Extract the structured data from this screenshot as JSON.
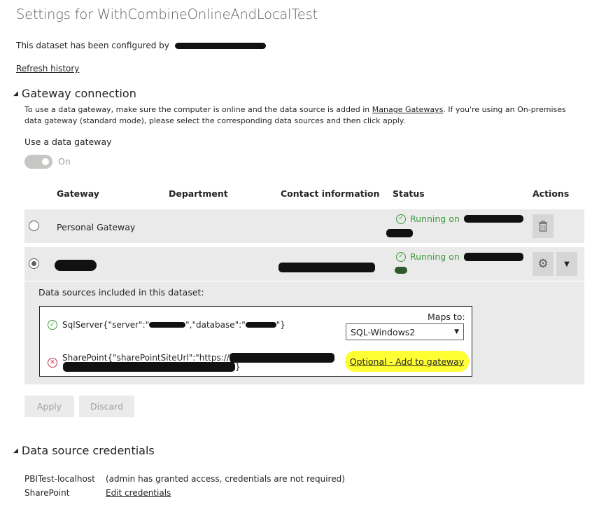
{
  "page": {
    "title": "Settings for WithCombineOnlineAndLocalTest",
    "configured_by": "This dataset has been configured by",
    "refresh_history": "Refresh history"
  },
  "gateway": {
    "section_title": "Gateway connection",
    "desc_before": "To use a data gateway, make sure the computer is online and the data source is added in ",
    "manage_link": "Manage Gateways",
    "desc_after": ". If you're using an On-premises data gateway (standard mode), please select the corresponding data sources and then click apply.",
    "use_label": "Use a data gateway",
    "toggle_label": "On",
    "columns": {
      "gateway": "Gateway",
      "department": "Department",
      "contact": "Contact information",
      "status": "Status",
      "actions": "Actions"
    },
    "rows": [
      {
        "name": "Personal Gateway",
        "status": "Running on"
      },
      {
        "name": "",
        "status": "Running on"
      }
    ],
    "data_sources": {
      "title": "Data sources included in this dataset:",
      "maps_to": "Maps to:",
      "sql_source": "SqlServer{\"server\":\"",
      "sql_mid": "\",\"database\":\"",
      "sql_end": "\"}",
      "sql_mapping": "SQL-Windows2",
      "sp_source": "SharePoint{\"sharePointSiteUrl\":\"https://",
      "sp_end": "}",
      "sp_action": "Optional - Add to gateway"
    },
    "apply": "Apply",
    "discard": "Discard"
  },
  "credentials": {
    "section_title": "Data source credentials",
    "items": [
      {
        "name": "PBITest-localhost",
        "value": "(admin has granted access, credentials are not required)"
      },
      {
        "name": "SharePoint",
        "value": "Edit credentials"
      }
    ]
  },
  "colors": {
    "status_green": "#3e9b3e",
    "error_red": "#c4314b",
    "highlight_yellow": "#ffff33",
    "row_bg": "#eaeaea"
  }
}
